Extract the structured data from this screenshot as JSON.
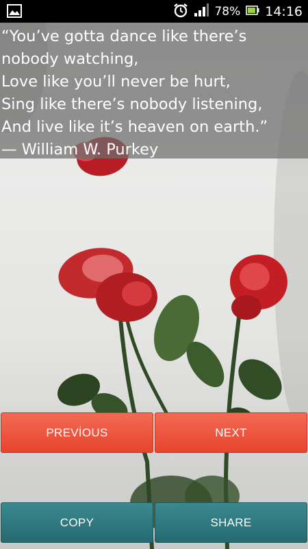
{
  "status_bar": {
    "battery_percent": "78%",
    "time": "14:16",
    "icons": [
      "gallery-icon",
      "alarm-icon",
      "signal-icon",
      "battery-icon"
    ]
  },
  "quote": {
    "lines": [
      "“You’ve gotta dance like there’s",
      "nobody watching,",
      "Love like you’ll never be hurt,",
      "Sing like there’s nobody listening,",
      "And live like it’s heaven on earth.”",
      "— William W. Purkey"
    ]
  },
  "buttons": {
    "previous": "PREVİOUS",
    "next": "NEXT",
    "copy": "COPY",
    "share": "SHARE"
  },
  "colors": {
    "red_button": "#e8442c",
    "teal_button": "#256a70",
    "rose": "#c8202a",
    "leaf": "#3b5a2c"
  }
}
